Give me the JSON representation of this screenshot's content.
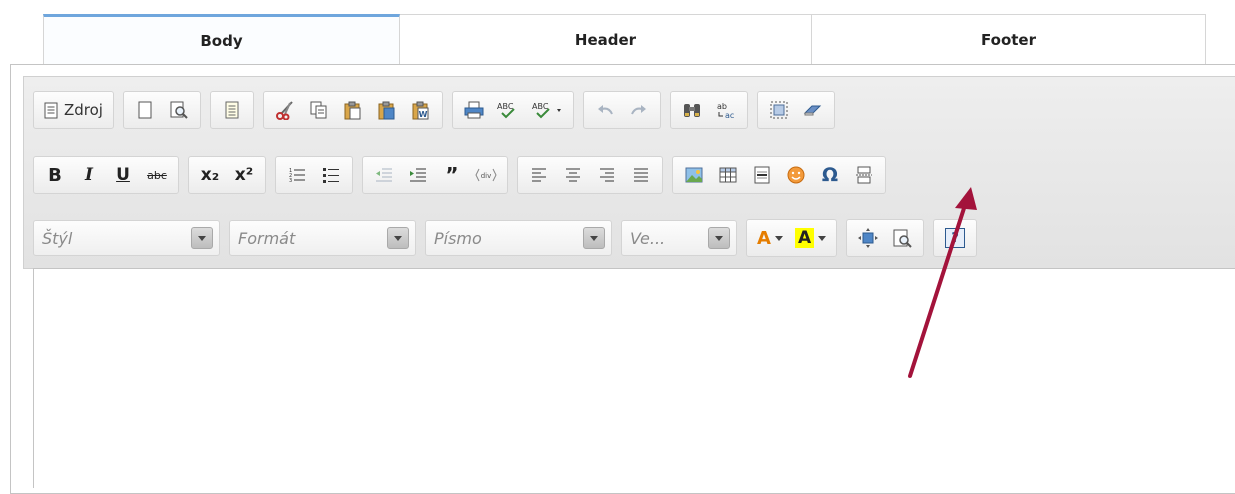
{
  "tabs": [
    {
      "label": "Body",
      "active": true
    },
    {
      "label": "Header",
      "active": false
    },
    {
      "label": "Footer",
      "active": false
    }
  ],
  "toolbar": {
    "source_label": "Zdroj",
    "bold_glyph": "B",
    "italic_glyph": "I",
    "underline_glyph": "U",
    "strike_glyph": "abc",
    "subscript_glyph": "x₂",
    "superscript_glyph": "x²",
    "blockquote_glyph": "”",
    "special_char_glyph": "Ω",
    "help_glyph": "?",
    "text_color_glyph": "A",
    "bg_color_glyph": "A",
    "spell1_glyph": "ABC",
    "spell2_glyph": "ABC",
    "div_glyph": "div"
  },
  "combos": {
    "style_placeholder": "Štýl",
    "format_placeholder": "Formát",
    "font_placeholder": "Písmo",
    "size_placeholder": "Ve..."
  },
  "colors": {
    "active_tab_accent": "#6fa6dd",
    "annotation_arrow": "#a3133b",
    "text_color_swatch": "#e57d00",
    "bg_color_swatch": "#ffff00"
  }
}
